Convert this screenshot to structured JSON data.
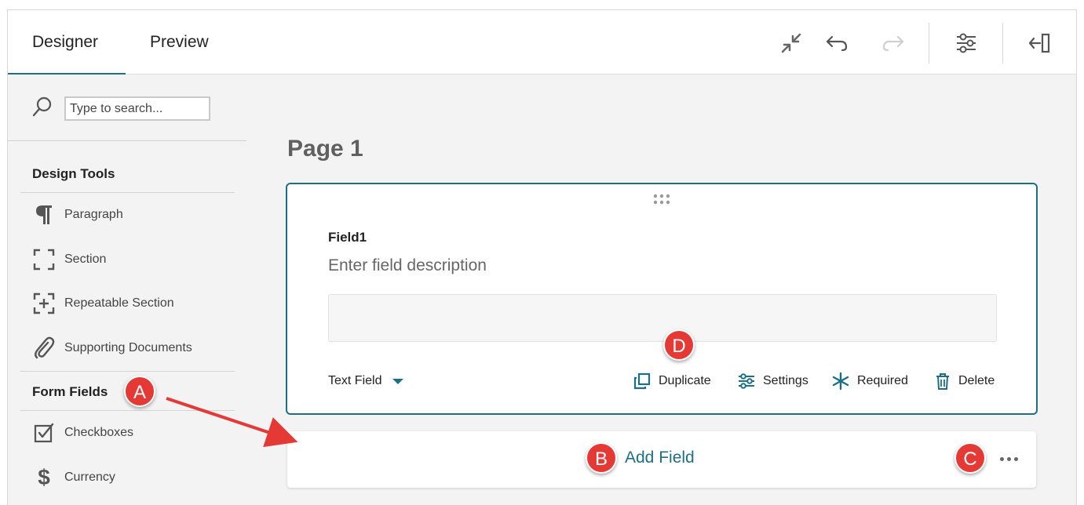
{
  "tabs": [
    {
      "label": "Designer",
      "active": true
    },
    {
      "label": "Preview",
      "active": false
    }
  ],
  "toolbar": {
    "icons": [
      "collapse-icon",
      "undo-icon",
      "redo-icon",
      "settings-sliders-icon",
      "collapse-panel-icon"
    ]
  },
  "sidebar": {
    "search_placeholder": "Type to search...",
    "design_tools_title": "Design Tools",
    "design_tools": [
      {
        "label": "Paragraph",
        "icon": "paragraph-icon"
      },
      {
        "label": "Section",
        "icon": "section-icon"
      },
      {
        "label": "Repeatable Section",
        "icon": "repeatable-section-icon"
      },
      {
        "label": "Supporting Documents",
        "icon": "paperclip-icon"
      }
    ],
    "form_fields_title": "Form Fields",
    "form_fields": [
      {
        "label": "Checkboxes",
        "icon": "checkbox-icon"
      },
      {
        "label": "Currency",
        "icon": "dollar-icon"
      }
    ]
  },
  "main": {
    "page_title": "Page 1",
    "field": {
      "label": "Field1",
      "description": "Enter field description",
      "type": "Text Field",
      "actions": {
        "duplicate": "Duplicate",
        "settings": "Settings",
        "required": "Required",
        "delete": "Delete"
      }
    },
    "add_field_label": "Add Field"
  },
  "callouts": {
    "a": "A",
    "b": "B",
    "c": "C",
    "d": "D"
  },
  "colors": {
    "accent": "#1d6f86",
    "callout": "#e53935"
  }
}
